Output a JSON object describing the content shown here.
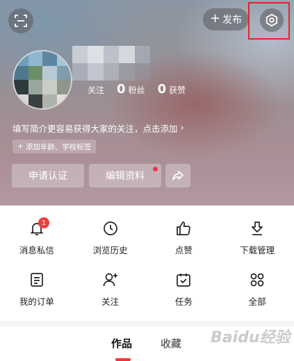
{
  "header": {
    "publish_label": "发布",
    "publish_plus": "+"
  },
  "profile": {
    "following_label_partial": "关注",
    "fans_count": "0",
    "fans_label": "粉丝",
    "likes_count": "0",
    "likes_label": "获赞",
    "bio_prompt": "填写简介更容易获得大家的关注，点击添加",
    "bio_chevron": "›",
    "tag_chip": "添加年龄、学校标签",
    "tag_plus": "+",
    "verify_label": "申请认证",
    "edit_label": "编辑资料"
  },
  "grid": {
    "items": [
      {
        "label": "消息私信",
        "icon": "bell-icon",
        "badge": "1"
      },
      {
        "label": "浏览历史",
        "icon": "clock-icon"
      },
      {
        "label": "点赞",
        "icon": "thumbs-up-icon"
      },
      {
        "label": "下载管理",
        "icon": "download-icon"
      },
      {
        "label": "我的订单",
        "icon": "order-icon"
      },
      {
        "label": "关注",
        "icon": "add-user-icon"
      },
      {
        "label": "任务",
        "icon": "calendar-check-icon"
      },
      {
        "label": "全部",
        "icon": "grid-icon"
      }
    ]
  },
  "tabs": {
    "works": "作品",
    "favorites": "收藏"
  },
  "watermark": "Baidu经验",
  "colors": {
    "accent_red": "#f1333f",
    "badge_red": "#f03e3e",
    "highlight_frame": "#e4222a"
  }
}
